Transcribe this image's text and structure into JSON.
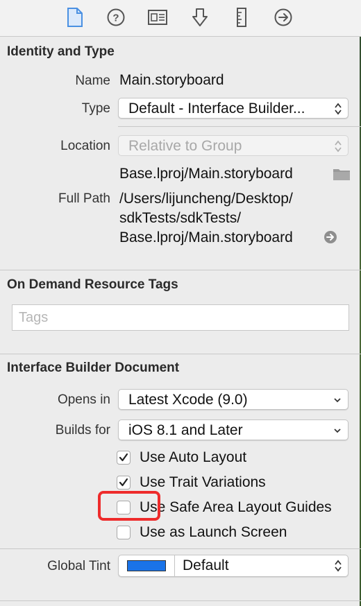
{
  "toolbar": {
    "icons": [
      "file-inspector-icon",
      "quick-help-icon",
      "identity-inspector-icon",
      "attributes-inspector-icon",
      "size-inspector-icon",
      "connections-inspector-icon"
    ]
  },
  "identity": {
    "title": "Identity and Type",
    "name_label": "Name",
    "name_value": "Main.storyboard",
    "type_label": "Type",
    "type_value": "Default - Interface Builder...",
    "location_label": "Location",
    "location_value": "Relative to Group",
    "location_path": "Base.lproj/Main.storyboard",
    "fullpath_label": "Full Path",
    "fullpath_line1": "/Users/lijuncheng/Desktop/",
    "fullpath_line2": "sdkTests/sdkTests/",
    "fullpath_line3": "Base.lproj/Main.storyboard"
  },
  "tags": {
    "title": "On Demand Resource Tags",
    "placeholder": "Tags",
    "value": ""
  },
  "ibdoc": {
    "title": "Interface Builder Document",
    "opens_in_label": "Opens in",
    "opens_in_value": "Latest Xcode (9.0)",
    "builds_for_label": "Builds for",
    "builds_for_value": "iOS 8.1 and Later",
    "checkboxes": [
      {
        "label": "Use Auto Layout",
        "checked": true
      },
      {
        "label": "Use Trait Variations",
        "checked": true
      },
      {
        "label": "Use Safe Area Layout Guides",
        "checked": false
      },
      {
        "label": "Use as Launch Screen",
        "checked": false
      }
    ]
  },
  "tint": {
    "label": "Global Tint",
    "value": "Default",
    "swatch_color": "#1a73e8"
  },
  "colors": {
    "highlight": "#ee2b2b",
    "accent": "#4a90e2"
  }
}
